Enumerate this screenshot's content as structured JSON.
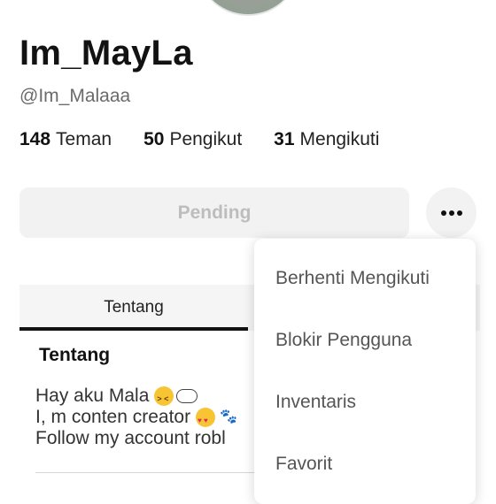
{
  "profile": {
    "display_name": "Im_MayLa",
    "username": "@Im_Malaaa"
  },
  "stats": [
    {
      "value": "148",
      "label": "Teman"
    },
    {
      "value": "50",
      "label": "Pengikut"
    },
    {
      "value": "31",
      "label": "Mengikuti"
    }
  ],
  "actions": {
    "pending_label": "Pending",
    "more_icon": "ellipsis-icon"
  },
  "tabs": [
    {
      "label": "Tentang",
      "active": true
    }
  ],
  "about": {
    "title": "Tentang",
    "bio_lines": [
      "Hay aku Mala",
      "I, m conten creator",
      "Follow my account robl"
    ]
  },
  "menu": {
    "items": [
      "Berhenti Mengikuti",
      "Blokir Pengguna",
      "Inventaris",
      "Favorit"
    ]
  },
  "colors": {
    "background": "#ffffff",
    "button_bg": "#f2f2f2",
    "muted_text": "#bdbdbd",
    "tab_indicator": "#121212"
  }
}
